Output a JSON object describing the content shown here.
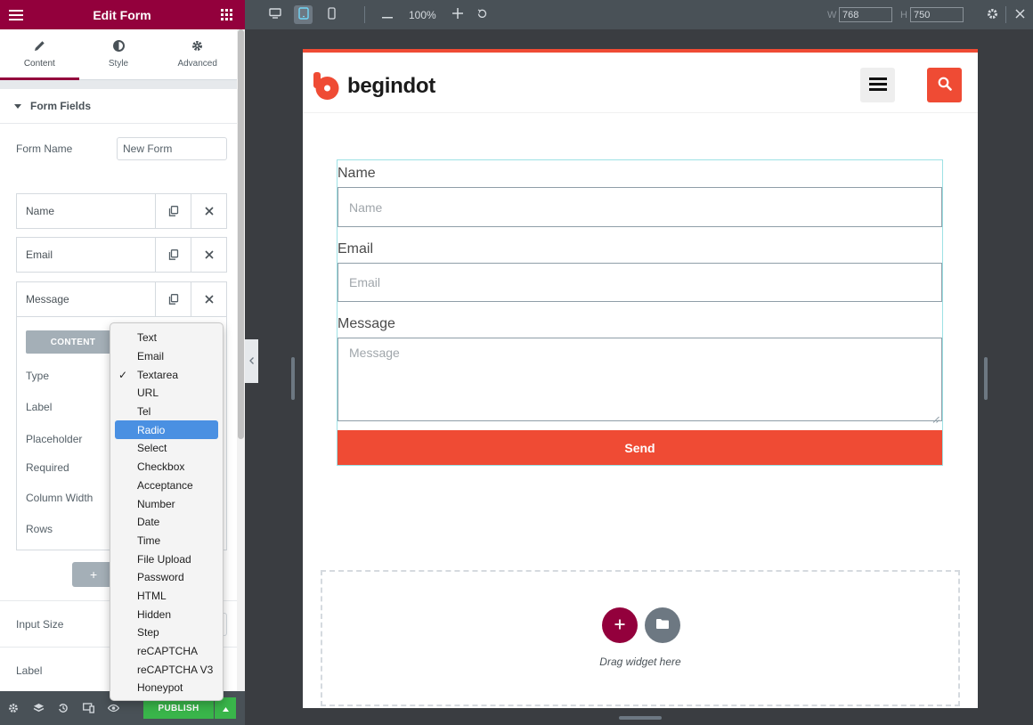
{
  "panel": {
    "title": "Edit Form",
    "tabs": [
      {
        "label": "Content",
        "icon": "pencil-icon",
        "active": true
      },
      {
        "label": "Style",
        "icon": "half-circle-icon",
        "active": false
      },
      {
        "label": "Advanced",
        "icon": "gear-icon",
        "active": false
      }
    ],
    "section_title": "Form Fields",
    "form_name_label": "Form Name",
    "form_name_value": "New Form",
    "fields": [
      {
        "title": "Name"
      },
      {
        "title": "Email"
      },
      {
        "title": "Message"
      }
    ],
    "field_editor": {
      "tab_label": "CONTENT",
      "labels": [
        "Type",
        "Label",
        "Placeholder",
        "Required",
        "Column Width",
        "Rows"
      ]
    },
    "add_item_label": "+",
    "input_size_label": "Input Size",
    "label_label": "Label",
    "publish_label": "PUBLISH",
    "type_options": [
      "Text",
      "Email",
      "Textarea",
      "URL",
      "Tel",
      "Radio",
      "Select",
      "Checkbox",
      "Acceptance",
      "Number",
      "Date",
      "Time",
      "File Upload",
      "Password",
      "HTML",
      "Hidden",
      "Step",
      "reCAPTCHA",
      "reCAPTCHA V3",
      "Honeypot"
    ],
    "type_selected": "Textarea",
    "type_highlighted": "Radio"
  },
  "topbar": {
    "zoom": "100%",
    "width_label": "W",
    "width_value": "768",
    "height_label": "H",
    "height_value": "750"
  },
  "site": {
    "logo_text": "begindot",
    "colors": {
      "accent": "#ef4b34",
      "brand": "#93003c"
    }
  },
  "form": {
    "fields": [
      {
        "label": "Name",
        "placeholder": "Name"
      },
      {
        "label": "Email",
        "placeholder": "Email"
      },
      {
        "label": "Message",
        "placeholder": "Message"
      }
    ],
    "submit_label": "Send"
  },
  "dropzone": {
    "text": "Drag widget here"
  }
}
